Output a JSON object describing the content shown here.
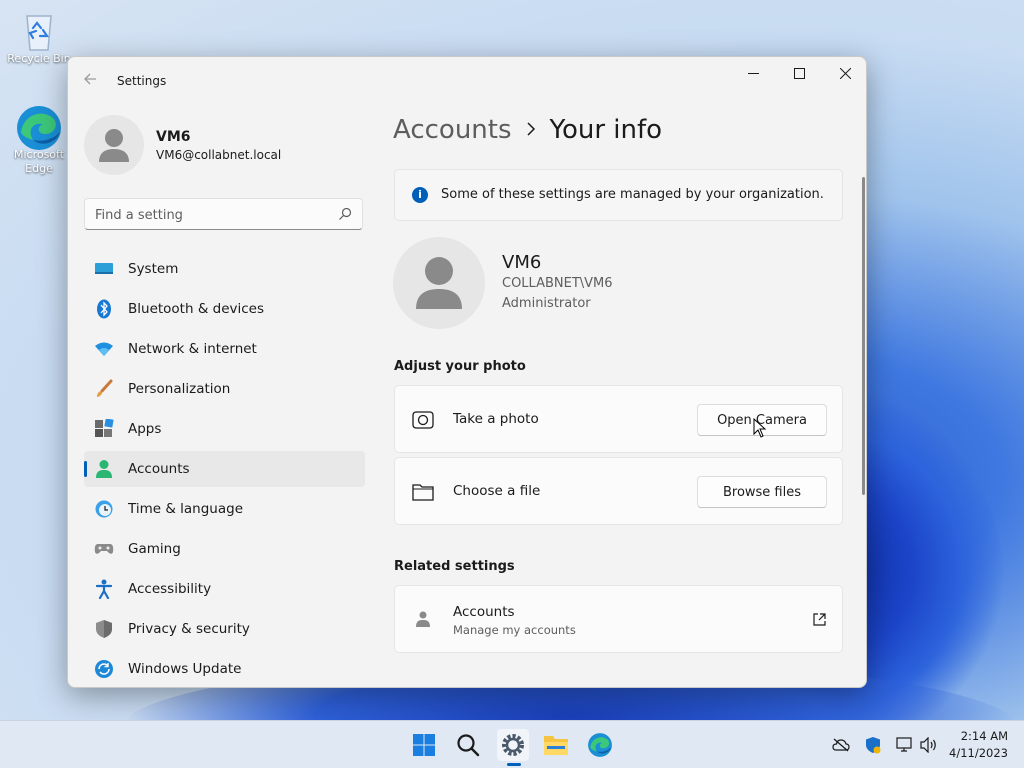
{
  "desktop": {
    "icons": [
      {
        "label": "Recycle Bin",
        "icon": "recycle-bin-icon"
      },
      {
        "label": "Microsoft Edge",
        "icon": "edge-icon"
      }
    ]
  },
  "window": {
    "title": "Settings",
    "controls": {
      "minimize": "minimize-icon",
      "maximize": "maximize-icon",
      "close": "close-icon"
    }
  },
  "sidebar": {
    "profile": {
      "name": "VM6",
      "email": "VM6@collabnet.local"
    },
    "search": {
      "placeholder": "Find a setting",
      "value": ""
    },
    "items": [
      {
        "label": "System",
        "icon": "system-icon",
        "active": false
      },
      {
        "label": "Bluetooth & devices",
        "icon": "bluetooth-icon",
        "active": false
      },
      {
        "label": "Network & internet",
        "icon": "wifi-icon",
        "active": false
      },
      {
        "label": "Personalization",
        "icon": "brush-icon",
        "active": false
      },
      {
        "label": "Apps",
        "icon": "apps-icon",
        "active": false
      },
      {
        "label": "Accounts",
        "icon": "accounts-icon",
        "active": true
      },
      {
        "label": "Time & language",
        "icon": "clock-globe-icon",
        "active": false
      },
      {
        "label": "Gaming",
        "icon": "gamepad-icon",
        "active": false
      },
      {
        "label": "Accessibility",
        "icon": "accessibility-icon",
        "active": false
      },
      {
        "label": "Privacy & security",
        "icon": "shield-icon",
        "active": false
      },
      {
        "label": "Windows Update",
        "icon": "update-icon",
        "active": false
      }
    ]
  },
  "main": {
    "breadcrumb": {
      "parent": "Accounts",
      "current": "Your info"
    },
    "notice": "Some of these settings are managed by your organization.",
    "user": {
      "name": "VM6",
      "domain": "COLLABNET\\VM6",
      "role": "Administrator"
    },
    "adjust_photo": {
      "title": "Adjust your photo",
      "rows": [
        {
          "label": "Take a photo",
          "icon": "camera-icon",
          "button": "Open Camera"
        },
        {
          "label": "Choose a file",
          "icon": "folder-icon",
          "button": "Browse files"
        }
      ]
    },
    "related": {
      "title": "Related settings",
      "item": {
        "label": "Accounts",
        "sublabel": "Manage my accounts",
        "icon": "person-icon",
        "action_icon": "open-external-icon"
      }
    }
  },
  "taskbar": {
    "apps": [
      "start-icon",
      "search-icon",
      "settings-icon",
      "file-explorer-icon",
      "edge-icon"
    ],
    "tray": [
      "cloud-offline-icon",
      "security-icon",
      "network-icon",
      "volume-icon"
    ],
    "time": "2:14 AM",
    "date": "4/11/2023"
  },
  "colors": {
    "accent": "#005fb8",
    "window_bg": "#f3f3f3",
    "card_bg": "#fbfbfb"
  }
}
